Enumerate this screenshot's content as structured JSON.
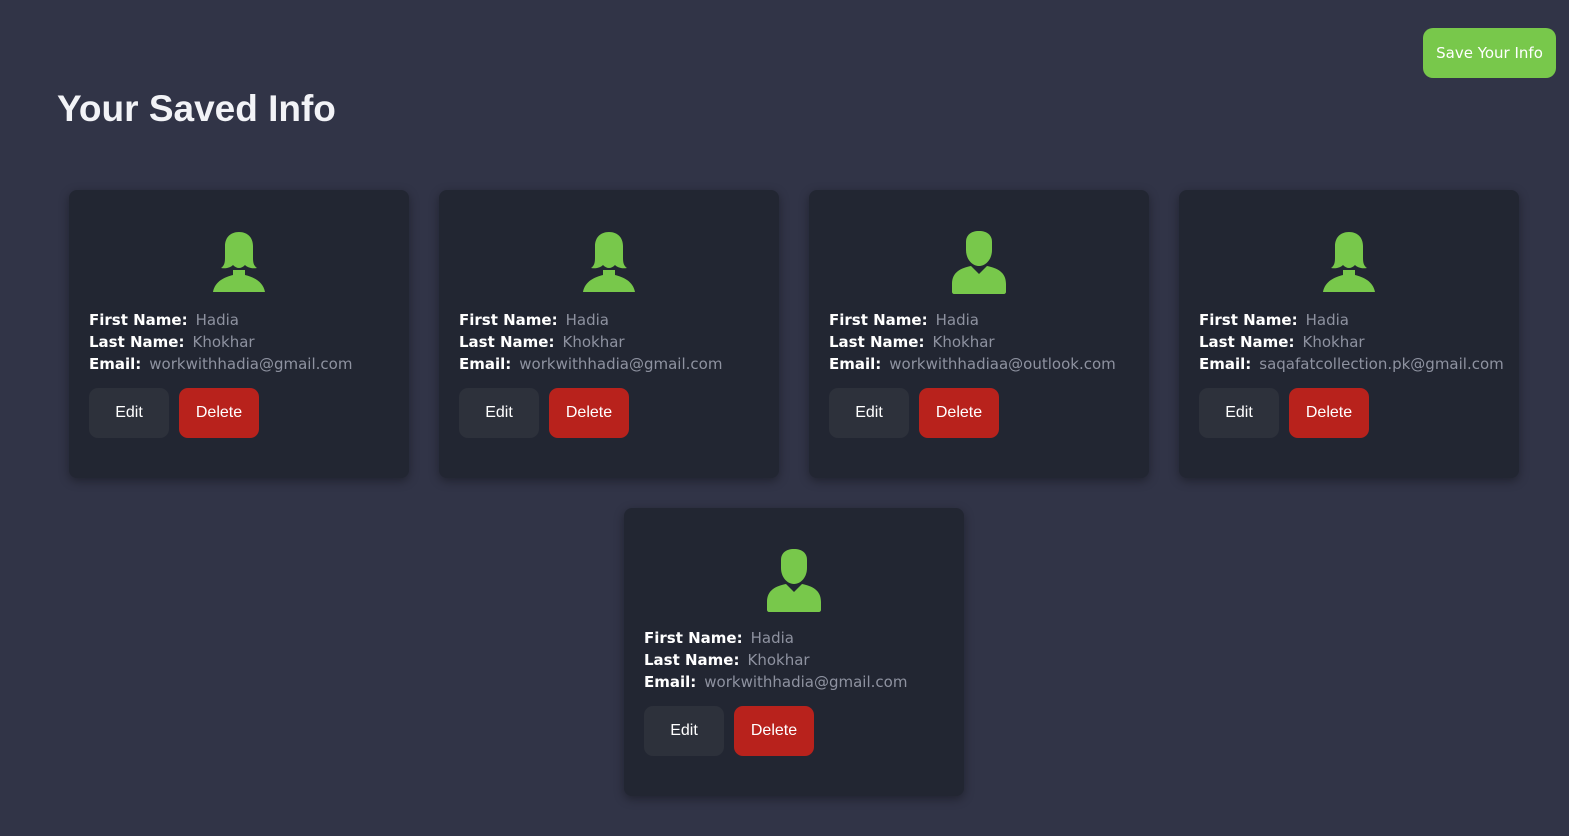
{
  "header": {
    "title": "Your Saved Info",
    "save_button": "Save Your Info"
  },
  "labels": {
    "first_name": "First Name:",
    "last_name": "Last Name:",
    "email": "Email:",
    "edit": "Edit",
    "delete": "Delete"
  },
  "colors": {
    "background": "#313447",
    "card": "#222632",
    "accent_green": "#78c84b",
    "delete_red": "#b8221c",
    "edit_gray": "#2d313b"
  },
  "cards": [
    {
      "avatar": "female-user-icon",
      "first_name": "Hadia",
      "last_name": "Khokhar",
      "email": "workwithhadia@gmail.com"
    },
    {
      "avatar": "female-user-icon",
      "first_name": "Hadia",
      "last_name": "Khokhar",
      "email": "workwithhadia@gmail.com"
    },
    {
      "avatar": "male-user-icon",
      "first_name": "Hadia",
      "last_name": "Khokhar",
      "email": "workwithhadiaa@outlook.com"
    },
    {
      "avatar": "female-user-icon",
      "first_name": "Hadia",
      "last_name": "Khokhar",
      "email": "saqafatcollection.pk@gmail.com"
    },
    {
      "avatar": "male-user-icon",
      "first_name": "Hadia",
      "last_name": "Khokhar",
      "email": "workwithhadia@gmail.com"
    }
  ]
}
